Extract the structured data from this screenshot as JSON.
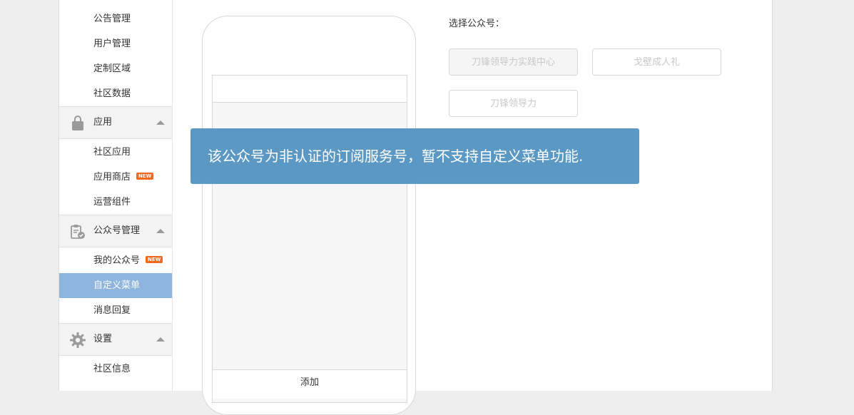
{
  "sidebar": {
    "top_items": [
      "公告管理",
      "用户管理",
      "定制区域",
      "社区数据"
    ],
    "groups": [
      {
        "label": "应用",
        "icon": "shopping-bag-icon",
        "items": [
          {
            "label": "社区应用"
          },
          {
            "label": "应用商店",
            "badge": "NEW"
          },
          {
            "label": "运营组件"
          }
        ]
      },
      {
        "label": "公众号管理",
        "icon": "clipboard-check-icon",
        "items": [
          {
            "label": "我的公众号",
            "badge": "NEW"
          },
          {
            "label": "自定义菜单",
            "active": true
          },
          {
            "label": "消息回复"
          }
        ]
      },
      {
        "label": "设置",
        "icon": "gear-icon",
        "items": [
          {
            "label": "社区信息"
          }
        ]
      }
    ]
  },
  "phone": {
    "add_label": "添加"
  },
  "accounts": {
    "label": "选择公众号：",
    "options": [
      "刀锋领导力实践中心",
      "戈壁成人礼",
      "刀锋领导力"
    ],
    "selected_index": 0
  },
  "toast": {
    "message": "该公众号为非认证的订阅服务号，暂不支持自定义菜单功能."
  },
  "colors": {
    "active_nav": "#8db5de",
    "toast_bg": "#5595c2",
    "badge": "#f36a1f"
  }
}
